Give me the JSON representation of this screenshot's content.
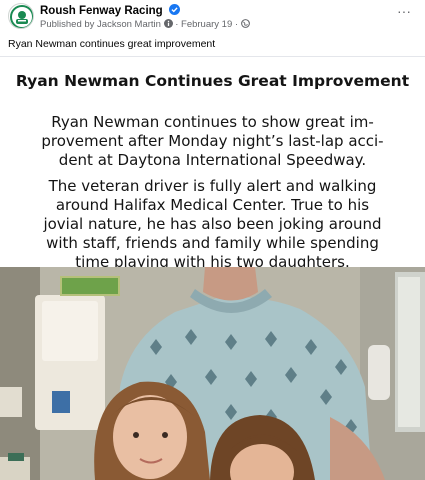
{
  "post": {
    "page_name": "Roush Fenway Racing",
    "byline": "Published by Jackson Martin",
    "date": "February 19",
    "separator": "·",
    "more_label": "···",
    "caption": "Ryan Newman continues great improvement"
  },
  "article": {
    "headline": "Ryan Newman Continues Great Improvement",
    "paragraph1": "Ryan Newman continues to show great im-provement after Monday night’s last-lap acci-dent at Daytona International Speedway.",
    "paragraph2": "The veteran driver is fully alert and walking around Halifax Medical Center. True to his jovial nature, he has also been joking around with staff, friends and family while spending time playing with his two daughters."
  },
  "icons": {
    "avatar": "roush-fenway-logo-icon",
    "verified": "verified-badge-icon",
    "info": "info-icon",
    "globe": "globe-icon",
    "more": "more-options-icon"
  },
  "colors": {
    "verified_blue": "#1877f2",
    "secondary_text": "#65676b",
    "brand_green": "#1a8a52"
  }
}
